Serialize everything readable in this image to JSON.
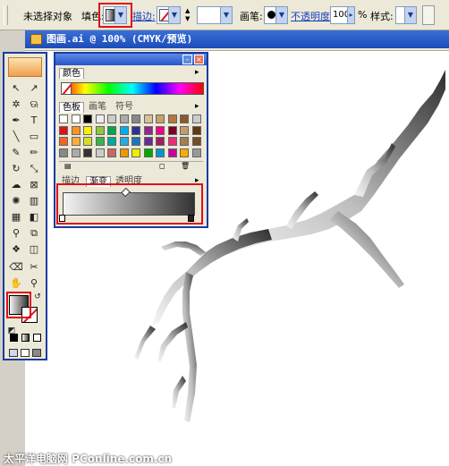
{
  "control_bar": {
    "selection_status": "未选择对象",
    "fill_label": "填色:",
    "stroke_label": "描边:",
    "brush_label": "画笔:",
    "opacity_label": "不透明度:",
    "opacity_value": "100",
    "opacity_unit": "%",
    "style_label": "样式:"
  },
  "document": {
    "title": "图画.ai @ 100% (CMYK/预览)"
  },
  "color_panel": {
    "tab_label": "颜色"
  },
  "swatches_panel": {
    "tabs": [
      "色板",
      "画笔",
      "符号"
    ]
  },
  "gradient_panel": {
    "tabs": [
      "描边",
      "渐变",
      "透明度"
    ]
  },
  "watermark": "太平洋电脑网 PConline.com.cn",
  "colors": {
    "highlight": "#e0101a",
    "panel_border": "#1a3c9e"
  }
}
